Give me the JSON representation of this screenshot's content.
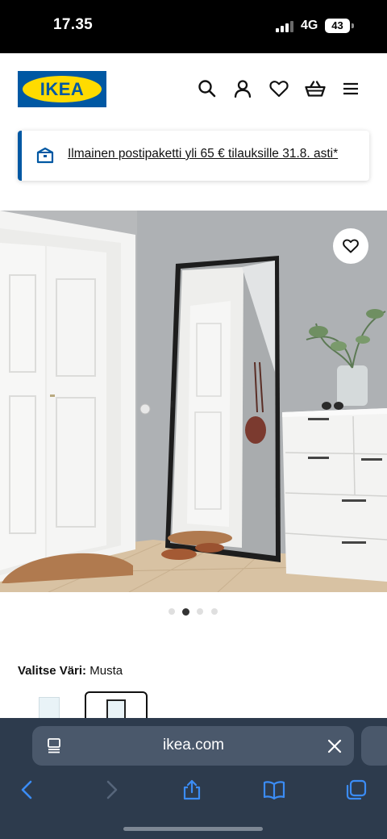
{
  "status_bar": {
    "time": "17.35",
    "network": "4G",
    "battery": "43"
  },
  "header": {
    "logo_text": "IKEA",
    "icons": [
      "search-icon",
      "account-icon",
      "heart-icon",
      "cart-icon",
      "menu-icon"
    ]
  },
  "promo": {
    "text": "Ilmainen postipaketti yli 65 € tilauksille 31.8. asti*",
    "icon": "delivery-box-icon"
  },
  "gallery": {
    "slide_count": 4,
    "active_slide": 2
  },
  "color_select": {
    "label": "Valitse Väri:",
    "value": "Musta"
  },
  "browser": {
    "url": "ikea.com",
    "toolbar": [
      "back-icon",
      "forward-icon",
      "share-icon",
      "bookmarks-icon",
      "tabs-icon"
    ]
  },
  "colors": {
    "ikea_blue": "#0058a3",
    "ikea_yellow": "#ffdb00",
    "safari_bar": "#2d3b4d",
    "safari_accent": "#3b8cf5"
  }
}
